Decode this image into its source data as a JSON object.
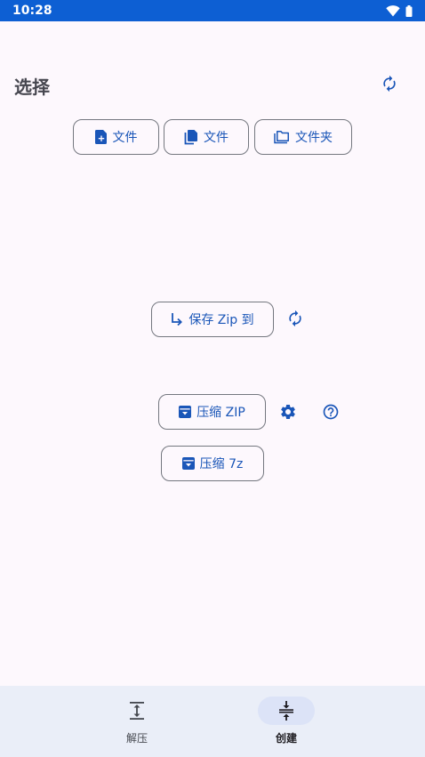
{
  "status_bar": {
    "time": "10:28"
  },
  "header": {
    "title": "选择"
  },
  "file_buttons": [
    {
      "label": "文件",
      "icon": "file-add-icon"
    },
    {
      "label": "文件",
      "icon": "files-copy-icon"
    },
    {
      "label": "文件夹",
      "icon": "folder-icon"
    }
  ],
  "save": {
    "label": "保存 Zip 到",
    "icon": "arrow-subdirectory-icon"
  },
  "compress": {
    "zip_label": "压缩 ZIP",
    "sevenz_label": "压缩 7z",
    "icon": "archive-icon"
  },
  "bottom_nav": {
    "items": [
      {
        "label": "解压",
        "icon": "expand-vertical-icon",
        "active": false
      },
      {
        "label": "创建",
        "icon": "compress-vertical-icon",
        "active": true
      }
    ]
  },
  "colors": {
    "status_bar": "#0d5fd3",
    "accent": "#1a56b8",
    "background": "#fdf8fd",
    "nav_background": "#eaeef8",
    "nav_active_pill": "#dce3f7"
  }
}
